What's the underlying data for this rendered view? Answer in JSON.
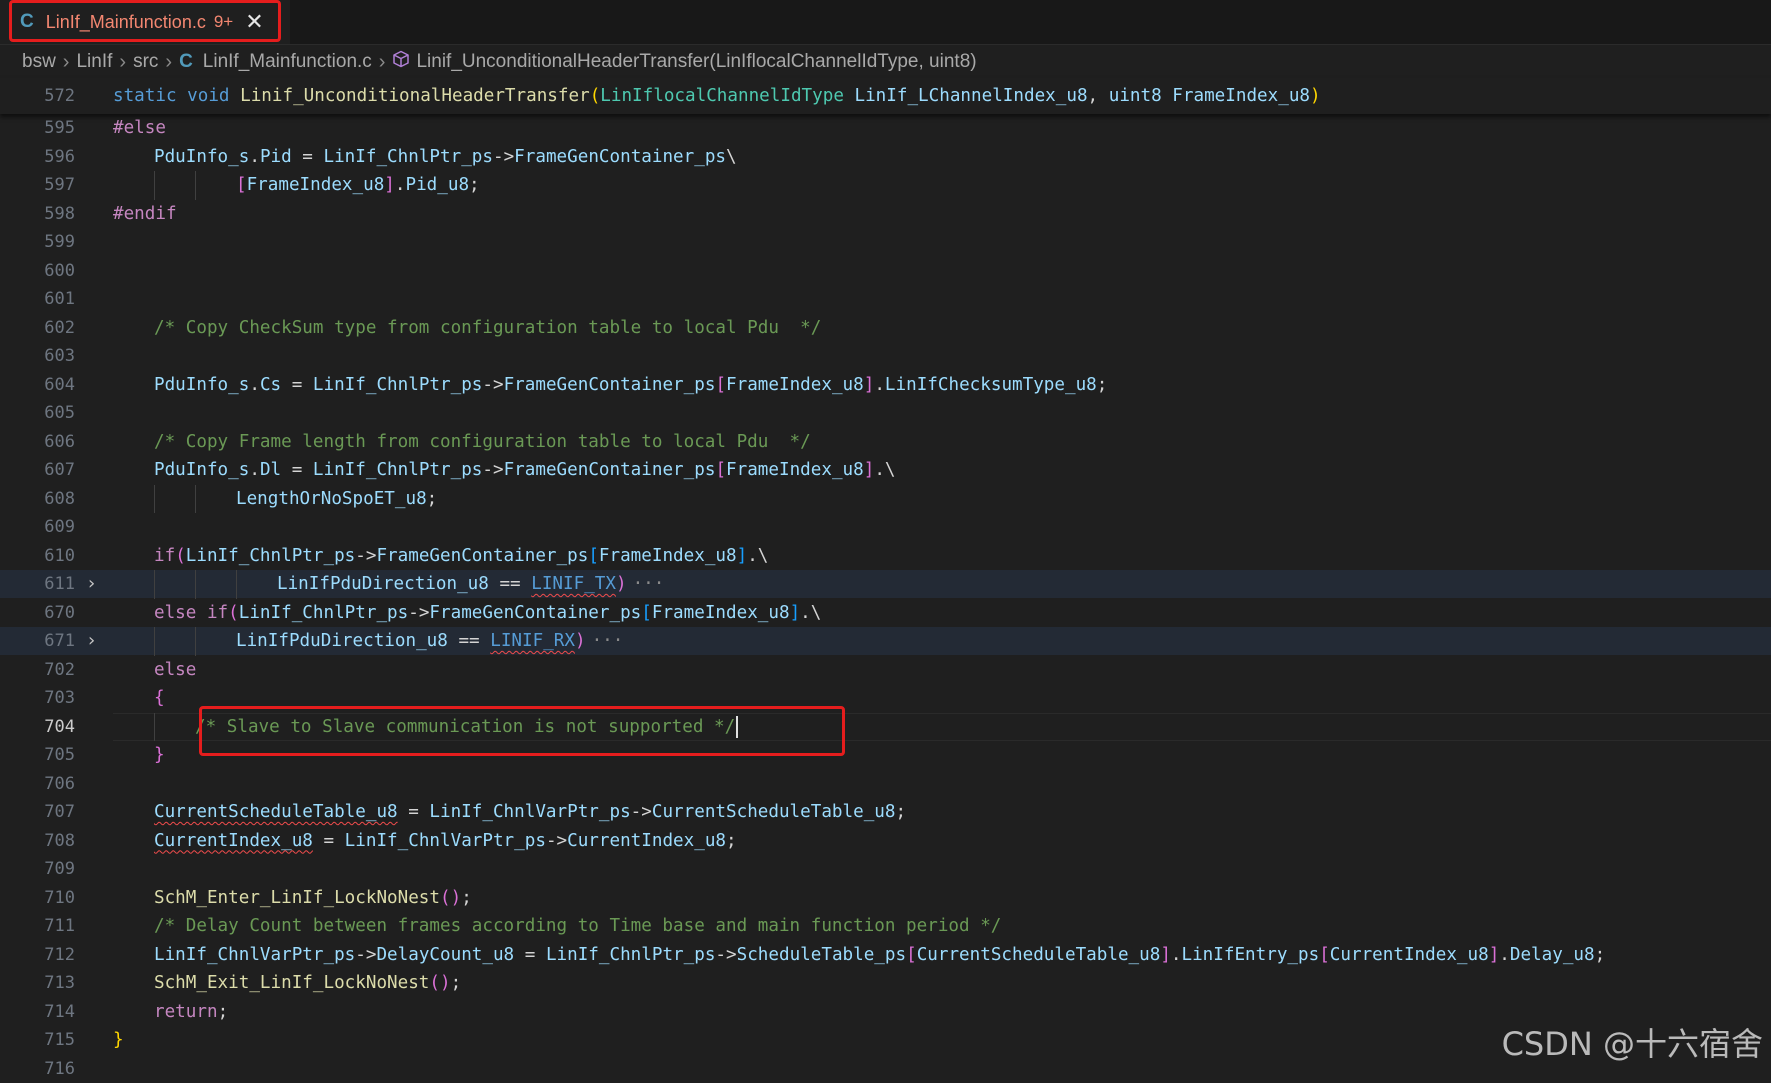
{
  "tab": {
    "language_icon": "C",
    "filename": "LinIf_Mainfunction.c",
    "problem_count": "9+",
    "close_glyph": "✕"
  },
  "breadcrumb": {
    "items": [
      "bsw",
      "LinIf",
      "src",
      "LinIf_Mainfunction.c",
      "Linif_UnconditionalHeaderTransfer(LinIflocalChannelIdType, uint8)"
    ],
    "file_icon": "C",
    "symbol_icon": "cube-icon"
  },
  "sticky": {
    "line_number": "572",
    "tokens": [
      "static",
      "void",
      "Linif_UnconditionalHeaderTransfer",
      "(",
      "LinIflocalChannelIdType",
      "LinIf_LChannelIndex_u8",
      ",",
      "uint8",
      "FrameIndex_u8",
      ")"
    ]
  },
  "lines": [
    {
      "num": "595",
      "tokens": [
        {
          "t": "#else",
          "c": "pp"
        }
      ]
    },
    {
      "num": "596",
      "tokens": [
        {
          "t": "PduInfo_s",
          "c": "va"
        },
        {
          "t": ".",
          "c": "tx"
        },
        {
          "t": "Pid",
          "c": "va"
        },
        {
          "t": " = ",
          "c": "tx"
        },
        {
          "t": "LinIf_ChnlPtr_ps",
          "c": "va"
        },
        {
          "t": "->",
          "c": "tx"
        },
        {
          "t": "FrameGenContainer_ps",
          "c": "va"
        },
        {
          "t": "\\",
          "c": "tx"
        }
      ]
    },
    {
      "num": "597",
      "tokens": [
        {
          "t": "[",
          "c": "br2"
        },
        {
          "t": "FrameIndex_u8",
          "c": "va"
        },
        {
          "t": "]",
          "c": "br2"
        },
        {
          "t": ".",
          "c": "tx"
        },
        {
          "t": "Pid_u8",
          "c": "va"
        },
        {
          "t": ";",
          "c": "tx"
        }
      ]
    },
    {
      "num": "598",
      "tokens": [
        {
          "t": "#endif",
          "c": "pp"
        }
      ]
    },
    {
      "num": "599",
      "tokens": []
    },
    {
      "num": "600",
      "tokens": []
    },
    {
      "num": "601",
      "tokens": []
    },
    {
      "num": "602",
      "tokens": [
        {
          "t": "/* Copy CheckSum type from configuration table to local Pdu  */",
          "c": "cm"
        }
      ]
    },
    {
      "num": "603",
      "tokens": []
    },
    {
      "num": "604",
      "tokens": [
        {
          "t": "PduInfo_s",
          "c": "va"
        },
        {
          "t": ".",
          "c": "tx"
        },
        {
          "t": "Cs",
          "c": "va"
        },
        {
          "t": " = ",
          "c": "tx"
        },
        {
          "t": "LinIf_ChnlPtr_ps",
          "c": "va"
        },
        {
          "t": "->",
          "c": "tx"
        },
        {
          "t": "FrameGenContainer_ps",
          "c": "va"
        },
        {
          "t": "[",
          "c": "br2"
        },
        {
          "t": "FrameIndex_u8",
          "c": "va"
        },
        {
          "t": "]",
          "c": "br2"
        },
        {
          "t": ".",
          "c": "tx"
        },
        {
          "t": "LinIfChecksumType_u8",
          "c": "va"
        },
        {
          "t": ";",
          "c": "tx"
        }
      ]
    },
    {
      "num": "605",
      "tokens": []
    },
    {
      "num": "606",
      "tokens": [
        {
          "t": "/* Copy Frame length from configuration table to local Pdu  */",
          "c": "cm"
        }
      ]
    },
    {
      "num": "607",
      "tokens": [
        {
          "t": "PduInfo_s",
          "c": "va"
        },
        {
          "t": ".",
          "c": "tx"
        },
        {
          "t": "Dl",
          "c": "va"
        },
        {
          "t": " = ",
          "c": "tx"
        },
        {
          "t": "LinIf_ChnlPtr_ps",
          "c": "va"
        },
        {
          "t": "->",
          "c": "tx"
        },
        {
          "t": "FrameGenContainer_ps",
          "c": "va"
        },
        {
          "t": "[",
          "c": "br2"
        },
        {
          "t": "FrameIndex_u8",
          "c": "va"
        },
        {
          "t": "]",
          "c": "br2"
        },
        {
          "t": ".\\",
          "c": "tx"
        }
      ]
    },
    {
      "num": "608",
      "tokens": [
        {
          "t": "LengthOrNoSpoET_u8",
          "c": "va"
        },
        {
          "t": ";",
          "c": "tx"
        }
      ]
    },
    {
      "num": "609",
      "tokens": []
    },
    {
      "num": "610",
      "tokens": [
        {
          "t": "if",
          "c": "ctl"
        },
        {
          "t": "(",
          "c": "br2"
        },
        {
          "t": "LinIf_ChnlPtr_ps",
          "c": "va"
        },
        {
          "t": "->",
          "c": "tx"
        },
        {
          "t": "FrameGenContainer_ps",
          "c": "va"
        },
        {
          "t": "[",
          "c": "br3"
        },
        {
          "t": "FrameIndex_u8",
          "c": "va"
        },
        {
          "t": "]",
          "c": "br3"
        },
        {
          "t": ".\\",
          "c": "tx"
        }
      ]
    },
    {
      "num": "611",
      "tokens": [
        {
          "t": "LinIfPduDirection_u8",
          "c": "va"
        },
        {
          "t": " == ",
          "c": "tx"
        },
        {
          "t": "LINIF_TX",
          "c": "macro squig"
        },
        {
          "t": ")",
          "c": "br2"
        },
        {
          "t": "···",
          "c": "ellip"
        }
      ]
    },
    {
      "num": "670",
      "tokens": [
        {
          "t": "else",
          "c": "ctl"
        },
        {
          "t": " ",
          "c": "tx"
        },
        {
          "t": "if",
          "c": "ctl"
        },
        {
          "t": "(",
          "c": "br2"
        },
        {
          "t": "LinIf_ChnlPtr_ps",
          "c": "va"
        },
        {
          "t": "->",
          "c": "tx"
        },
        {
          "t": "FrameGenContainer_ps",
          "c": "va"
        },
        {
          "t": "[",
          "c": "br3"
        },
        {
          "t": "FrameIndex_u8",
          "c": "va"
        },
        {
          "t": "]",
          "c": "br3"
        },
        {
          "t": ".\\",
          "c": "tx"
        }
      ]
    },
    {
      "num": "671",
      "tokens": [
        {
          "t": "LinIfPduDirection_u8",
          "c": "va"
        },
        {
          "t": " == ",
          "c": "tx"
        },
        {
          "t": "LINIF_RX",
          "c": "macro squig"
        },
        {
          "t": ")",
          "c": "br2"
        },
        {
          "t": "···",
          "c": "ellip"
        }
      ]
    },
    {
      "num": "702",
      "tokens": [
        {
          "t": "else",
          "c": "ctl"
        }
      ]
    },
    {
      "num": "703",
      "tokens": [
        {
          "t": "{",
          "c": "br2"
        }
      ]
    },
    {
      "num": "704",
      "tokens": [
        {
          "t": "/* Slave to Slave communication is not supported */",
          "c": "cm"
        }
      ]
    },
    {
      "num": "705",
      "tokens": [
        {
          "t": "}",
          "c": "br2"
        }
      ]
    },
    {
      "num": "706",
      "tokens": []
    },
    {
      "num": "707",
      "tokens": [
        {
          "t": "CurrentScheduleTable_u8",
          "c": "va squig"
        },
        {
          "t": " = ",
          "c": "tx"
        },
        {
          "t": "LinIf_ChnlVarPtr_ps",
          "c": "va"
        },
        {
          "t": "->",
          "c": "tx"
        },
        {
          "t": "CurrentScheduleTable_u8",
          "c": "va"
        },
        {
          "t": ";",
          "c": "tx"
        }
      ]
    },
    {
      "num": "708",
      "tokens": [
        {
          "t": "CurrentIndex_u8",
          "c": "va squig"
        },
        {
          "t": " = ",
          "c": "tx"
        },
        {
          "t": "LinIf_ChnlVarPtr_ps",
          "c": "va"
        },
        {
          "t": "->",
          "c": "tx"
        },
        {
          "t": "CurrentIndex_u8",
          "c": "va"
        },
        {
          "t": ";",
          "c": "tx"
        }
      ]
    },
    {
      "num": "709",
      "tokens": []
    },
    {
      "num": "710",
      "tokens": [
        {
          "t": "SchM_Enter_LinIf_LockNoNest",
          "c": "fn"
        },
        {
          "t": "()",
          "c": "br2"
        },
        {
          "t": ";",
          "c": "tx"
        }
      ]
    },
    {
      "num": "711",
      "tokens": [
        {
          "t": "/* Delay Count between frames according to Time base and main function period */",
          "c": "cm"
        }
      ]
    },
    {
      "num": "712",
      "tokens": [
        {
          "t": "LinIf_ChnlVarPtr_ps",
          "c": "va"
        },
        {
          "t": "->",
          "c": "tx"
        },
        {
          "t": "DelayCount_u8",
          "c": "va"
        },
        {
          "t": " = ",
          "c": "tx"
        },
        {
          "t": "LinIf_ChnlPtr_ps",
          "c": "va"
        },
        {
          "t": "->",
          "c": "tx"
        },
        {
          "t": "ScheduleTable_ps",
          "c": "va"
        },
        {
          "t": "[",
          "c": "br2"
        },
        {
          "t": "CurrentScheduleTable_u8",
          "c": "va"
        },
        {
          "t": "]",
          "c": "br2"
        },
        {
          "t": ".",
          "c": "tx"
        },
        {
          "t": "LinIfEntry_ps",
          "c": "va"
        },
        {
          "t": "[",
          "c": "br2"
        },
        {
          "t": "CurrentIndex_u8",
          "c": "va"
        },
        {
          "t": "]",
          "c": "br2"
        },
        {
          "t": ".",
          "c": "tx"
        },
        {
          "t": "Delay_u8",
          "c": "va"
        },
        {
          "t": ";",
          "c": "tx"
        }
      ]
    },
    {
      "num": "713",
      "tokens": [
        {
          "t": "SchM_Exit_LinIf_LockNoNest",
          "c": "fn"
        },
        {
          "t": "()",
          "c": "br2"
        },
        {
          "t": ";",
          "c": "tx"
        }
      ]
    },
    {
      "num": "714",
      "tokens": [
        {
          "t": "return",
          "c": "ctl"
        },
        {
          "t": ";",
          "c": "tx"
        }
      ]
    },
    {
      "num": "715",
      "tokens": [
        {
          "t": "}",
          "c": "br1"
        }
      ]
    },
    {
      "num": "716",
      "tokens": []
    }
  ],
  "active_line": "704",
  "watermark": "CSDN @十六宿舍",
  "colors": {
    "background": "#1f1f1f",
    "tab_error_text": "#f48771",
    "highlight_box": "#e51d1d",
    "comment": "#6a9955",
    "keyword": "#569cd6",
    "control": "#c586c0",
    "variable": "#9cdcfe",
    "function": "#dcdcaa",
    "type": "#4ec9b0"
  }
}
